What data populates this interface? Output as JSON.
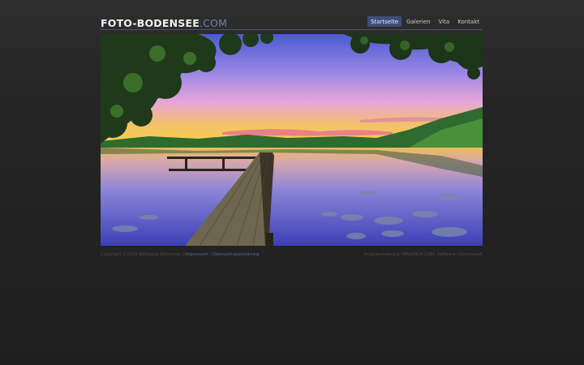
{
  "site": {
    "logo_main": "FOTO-BODENSEE",
    "logo_tld": ".COM"
  },
  "nav": {
    "items": [
      "Startseite",
      "Galerien",
      "Vita",
      "Kontakt"
    ],
    "active": "Startseite"
  },
  "footer": {
    "copyright": "Copyright ©2018 Wolfgang Schneider |",
    "impressum": "Impressum",
    "separator": "|",
    "datenschutz": "Datenschutzerklärung",
    "credits": "Programmierung: MAKERDA.COM, Software: Cosmossoft"
  },
  "colors": {
    "accent": "#6a82b4",
    "nav_active_bg": "#3d4f7a",
    "background": "#252525"
  }
}
